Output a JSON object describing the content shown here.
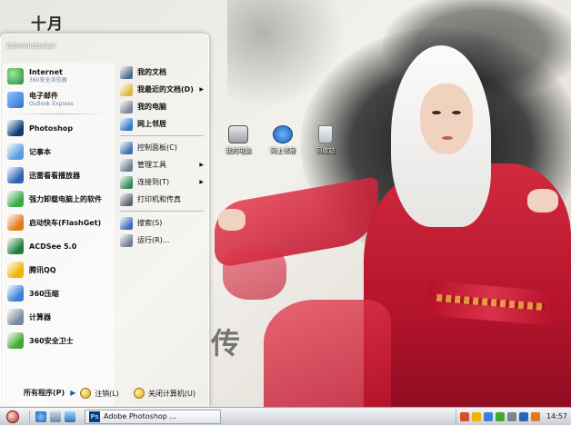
{
  "wallpaper": {
    "title_text": "十月",
    "stamp_text": "传"
  },
  "desktop_icons": [
    {
      "label": "我的电脑",
      "icon": "computer-icon"
    },
    {
      "label": "网上邻居",
      "icon": "network-icon"
    },
    {
      "label": "回收站",
      "icon": "recycle-bin-icon"
    }
  ],
  "start_menu": {
    "user": "Administrator",
    "pinned": [
      {
        "label": "Internet",
        "sub": "360安全浏览器",
        "icon": "internet-explorer-icon",
        "color": "#1f8a3a"
      },
      {
        "label": "电子邮件",
        "sub": "Outlook Express",
        "icon": "email-icon",
        "color": "#2a6fcf"
      }
    ],
    "recent": [
      {
        "label": "Photoshop",
        "icon": "photoshop-icon",
        "color": "#0d3c7a"
      },
      {
        "label": "记事本",
        "icon": "notepad-icon",
        "color": "#5a9ee0"
      },
      {
        "label": "迅雷看看播放器",
        "icon": "xunlei-player-icon",
        "color": "#2b62b8"
      },
      {
        "label": "强力卸载电脑上的软件",
        "icon": "uninstall-icon",
        "color": "#3aa84a"
      },
      {
        "label": "启动快车(FlashGet)",
        "icon": "flashget-icon",
        "color": "#e07a1a"
      },
      {
        "label": "ACDSee 5.0",
        "icon": "acdsee-icon",
        "color": "#1e7f3a"
      },
      {
        "label": "腾讯QQ",
        "icon": "qq-icon",
        "color": "#f0b400"
      },
      {
        "label": "360压缩",
        "icon": "compress-icon",
        "color": "#3d7dd8"
      },
      {
        "label": "计算器",
        "icon": "calculator-icon",
        "color": "#7a8a9a"
      },
      {
        "label": "360安全卫士",
        "icon": "360-safe-icon",
        "color": "#42a832"
      }
    ],
    "all_programs": "所有程序(P)",
    "right_items": [
      {
        "label": "我的文档",
        "icon": "documents-icon",
        "color": "#4f6a8c",
        "bold": true
      },
      {
        "label": "我最近的文档(D)",
        "icon": "recent-docs-icon",
        "color": "#e0b640",
        "bold": true,
        "arrow": "▶"
      },
      {
        "label": "我的电脑",
        "icon": "computer-icon",
        "color": "#7a8694",
        "bold": true
      },
      {
        "label": "网上邻居",
        "icon": "network-icon",
        "color": "#2f79c8",
        "bold": true
      },
      {
        "label": "控制面板(C)",
        "icon": "control-panel-icon",
        "color": "#3f6fb0"
      },
      {
        "label": "管理工具",
        "icon": "admin-tools-icon",
        "color": "#6b7f94",
        "arrow": "▶"
      },
      {
        "label": "连接到(T)",
        "icon": "connect-icon",
        "color": "#2e8b57",
        "arrow": "▶"
      },
      {
        "label": "打印机和传真",
        "icon": "printer-icon",
        "color": "#5b6570"
      },
      {
        "label": "搜索(S)",
        "icon": "search-icon",
        "color": "#3a6db4"
      },
      {
        "label": "运行(R)...",
        "icon": "run-icon",
        "color": "#6f7d8c"
      }
    ],
    "logoff": "注销(L)",
    "shutdown": "关闭计算机(U)"
  },
  "taskbar": {
    "task_label": "Adobe Photoshop ...",
    "task_icon_text": "Ps",
    "clock": "14:57"
  }
}
